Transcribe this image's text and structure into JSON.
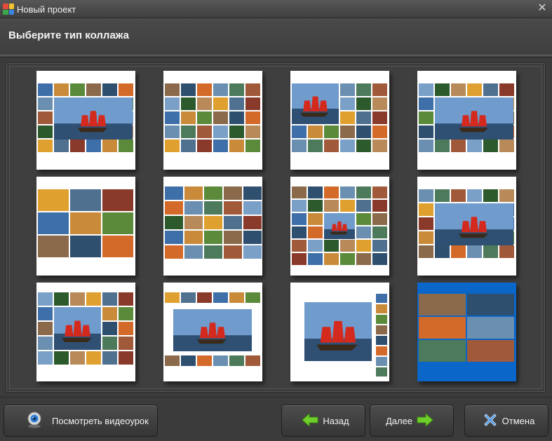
{
  "window": {
    "title": "Новый проект",
    "icon": "app-logo-icon",
    "close_icon": "close-icon"
  },
  "header": {
    "title": "Выберите тип коллажа"
  },
  "templates": [
    {
      "name": "collage-template-1",
      "layout": "large-center-ring",
      "selected": false
    },
    {
      "name": "collage-template-2",
      "layout": "grid-many-small",
      "selected": false
    },
    {
      "name": "collage-template-3",
      "layout": "large-left-grid",
      "selected": false
    },
    {
      "name": "collage-template-4",
      "layout": "large-center-ring",
      "selected": false
    },
    {
      "name": "collage-template-5",
      "layout": "grid-3x3",
      "selected": false
    },
    {
      "name": "collage-template-6",
      "layout": "mixed-rows",
      "selected": false
    },
    {
      "name": "collage-template-7",
      "layout": "grid-many-small-center",
      "selected": false
    },
    {
      "name": "collage-template-8",
      "layout": "large-center-ring",
      "selected": false
    },
    {
      "name": "collage-template-9",
      "layout": "large-upper-left",
      "selected": false
    },
    {
      "name": "collage-template-10",
      "layout": "large-center-border",
      "selected": false
    },
    {
      "name": "collage-template-11",
      "layout": "large-center-right-strip",
      "selected": false
    },
    {
      "name": "collage-template-12",
      "layout": "grid-2x3-blue",
      "selected": true
    }
  ],
  "buttons": {
    "video": "Посмотреть видеоурок",
    "back": "Назад",
    "next": "Далее",
    "cancel": "Отмена"
  },
  "colors": {
    "selected_border": "#0a66c8",
    "arrow_green": "#6fcf2a",
    "cancel_blue": "#3a8ee8"
  }
}
